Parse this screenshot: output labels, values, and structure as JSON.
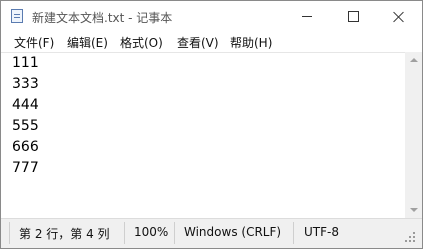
{
  "window": {
    "title": "新建文本文档.txt - 记事本"
  },
  "menu": {
    "items": [
      "文件(F)",
      "编辑(E)",
      "格式(O)",
      "查看(V)",
      "帮助(H)"
    ]
  },
  "editor": {
    "lines": [
      "111",
      "333",
      "444",
      "555",
      "666",
      "777"
    ]
  },
  "status": {
    "position": "第 2 行，第 4 列",
    "zoom": "100%",
    "line_ending": "Windows (CRLF)",
    "encoding": "UTF-8"
  },
  "icons": {
    "app": "notepad-icon",
    "minimize": "minimize-icon",
    "maximize": "maximize-icon",
    "close": "close-icon"
  }
}
